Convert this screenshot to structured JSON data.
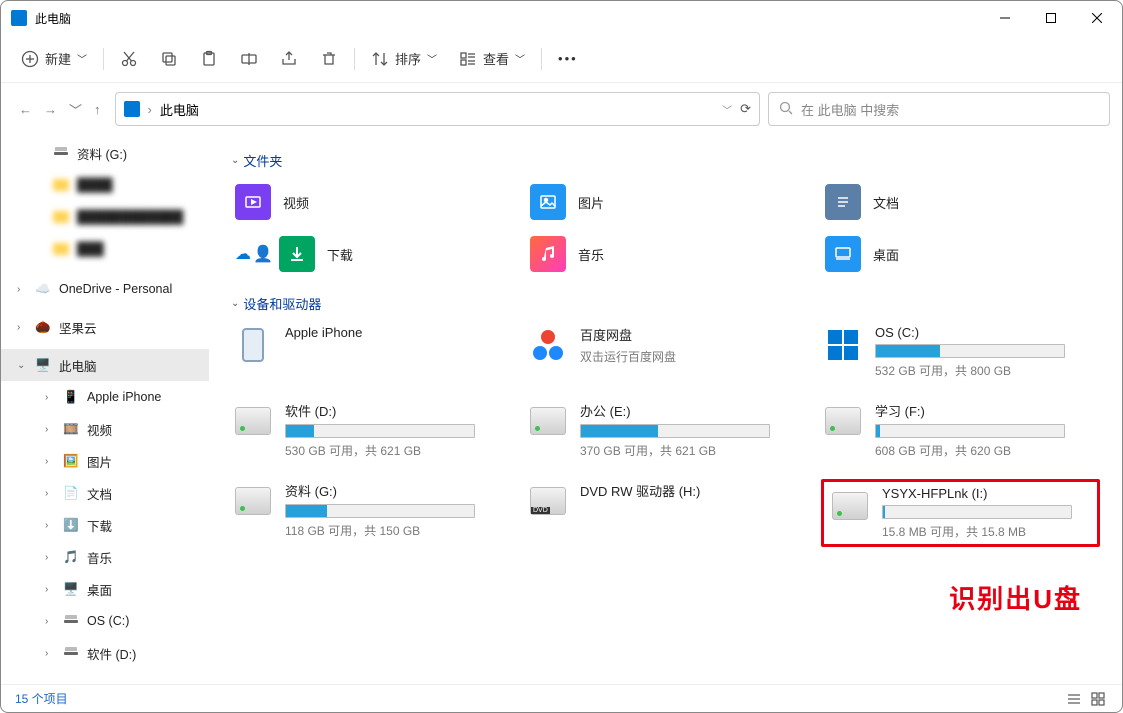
{
  "titlebar": {
    "title": "此电脑"
  },
  "toolbar": {
    "new_label": "新建",
    "sort_label": "排序",
    "view_label": "查看"
  },
  "address": {
    "path": "此电脑"
  },
  "search": {
    "placeholder": "在 此电脑 中搜索"
  },
  "sidebar": {
    "items": [
      {
        "label": "资料 (G:)"
      },
      {
        "label": "blurred-1"
      },
      {
        "label": "blurred-2"
      },
      {
        "label": "blurred-3"
      },
      {
        "label": "OneDrive - Personal"
      },
      {
        "label": "坚果云"
      },
      {
        "label": "此电脑"
      },
      {
        "label": "Apple iPhone"
      },
      {
        "label": "视频"
      },
      {
        "label": "图片"
      },
      {
        "label": "文档"
      },
      {
        "label": "下载"
      },
      {
        "label": "音乐"
      },
      {
        "label": "桌面"
      },
      {
        "label": "OS (C:)"
      },
      {
        "label": "软件 (D:)"
      }
    ]
  },
  "sections": {
    "folders_header": "文件夹",
    "drives_header": "设备和驱动器"
  },
  "folders": [
    {
      "label": "视频"
    },
    {
      "label": "图片"
    },
    {
      "label": "文档"
    },
    {
      "label": "下载"
    },
    {
      "label": "音乐"
    },
    {
      "label": "桌面"
    }
  ],
  "drives": {
    "iphone": {
      "name": "Apple iPhone"
    },
    "baidu": {
      "name": "百度网盘",
      "sub": "双击运行百度网盘"
    },
    "os": {
      "name": "OS (C:)",
      "sub": "532 GB 可用，共 800 GB",
      "fill": 34
    },
    "d": {
      "name": "软件 (D:)",
      "sub": "530 GB 可用，共 621 GB",
      "fill": 15
    },
    "e": {
      "name": "办公 (E:)",
      "sub": "370 GB 可用，共 621 GB",
      "fill": 41
    },
    "f": {
      "name": "学习 (F:)",
      "sub": "608 GB 可用，共 620 GB",
      "fill": 2
    },
    "g": {
      "name": "资料 (G:)",
      "sub": "118 GB 可用，共 150 GB",
      "fill": 22
    },
    "dvd": {
      "name": "DVD RW 驱动器 (H:)"
    },
    "usb": {
      "name": "YSYX-HFPLnk (I:)",
      "sub": "15.8 MB 可用，共 15.8 MB",
      "fill": 1
    }
  },
  "annotation": "识别出U盘",
  "status": {
    "count": "15 个项目"
  }
}
